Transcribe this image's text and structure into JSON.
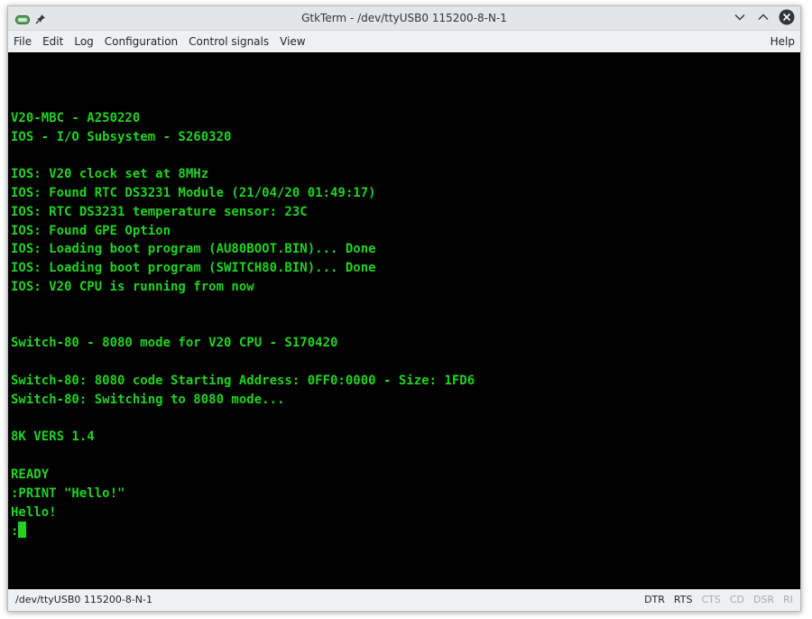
{
  "window": {
    "title": "GtkTerm - /dev/ttyUSB0 115200-8-N-1"
  },
  "menu": {
    "items": [
      "File",
      "Edit",
      "Log",
      "Configuration",
      "Control signals",
      "View"
    ],
    "help": "Help"
  },
  "terminal": {
    "lines": [
      "",
      "V20-MBC - A250220",
      "IOS - I/O Subsystem - S260320",
      "",
      "IOS: V20 clock set at 8MHz",
      "IOS: Found RTC DS3231 Module (21/04/20 01:49:17)",
      "IOS: RTC DS3231 temperature sensor: 23C",
      "IOS: Found GPE Option",
      "IOS: Loading boot program (AU80BOOT.BIN)... Done",
      "IOS: Loading boot program (SWITCH80.BIN)... Done",
      "IOS: V20 CPU is running from now",
      "",
      "",
      "Switch-80 - 8080 mode for V20 CPU - S170420",
      "",
      "Switch-80: 8080 code Starting Address: 0FF0:0000 - Size: 1FD6",
      "Switch-80: Switching to 8080 mode...",
      "",
      "8K VERS 1.4",
      "",
      "READY",
      ":PRINT \"Hello!\"",
      "Hello!"
    ],
    "prompt": ":",
    "text_color": "#1fd41f",
    "background": "#000000"
  },
  "status": {
    "port": "/dev/ttyUSB0  115200-8-N-1",
    "signals": [
      {
        "label": "DTR",
        "active": true
      },
      {
        "label": "RTS",
        "active": true
      },
      {
        "label": "CTS",
        "active": false
      },
      {
        "label": "CD",
        "active": false
      },
      {
        "label": "DSR",
        "active": false
      },
      {
        "label": "RI",
        "active": false
      }
    ]
  }
}
